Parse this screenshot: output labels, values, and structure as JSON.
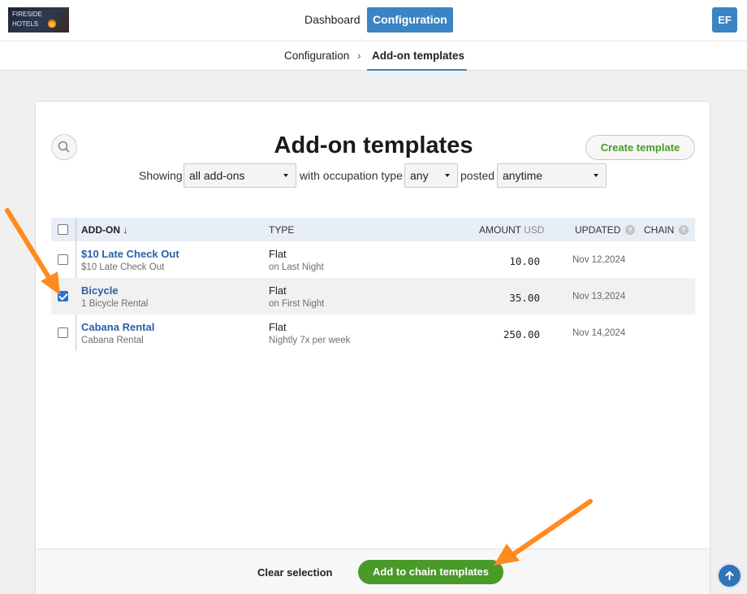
{
  "header": {
    "logo_text": "FIRESIDE HOTELS",
    "nav": [
      {
        "label": "Dashboard",
        "active": false
      },
      {
        "label": "Configuration",
        "active": true
      }
    ],
    "avatar_initials": "EF",
    "accent_color": "#3a84c4"
  },
  "breadcrumb": {
    "items": [
      "Configuration",
      "Add-on templates"
    ],
    "separator": "›"
  },
  "page": {
    "title": "Add-on templates",
    "create_button": "Create template"
  },
  "filters": {
    "showing_label": "Showing",
    "addons_value": "all add-ons",
    "occupation_label": "with occupation type",
    "occupation_value": "any",
    "posted_label": "posted",
    "posted_value": "anytime"
  },
  "table": {
    "columns": {
      "addon": "ADD-ON ↓",
      "type": "TYPE",
      "amount": "AMOUNT",
      "currency": "USD",
      "updated": "UPDATED",
      "chain": "CHAIN",
      "help_glyph": "?"
    },
    "rows": [
      {
        "name": "$10 Late Check Out",
        "subtitle": "$10 Late Check Out",
        "type": "Flat",
        "type_detail": "on Last Night",
        "amount": "10.00",
        "updated": "Nov 12,2024",
        "checked": false
      },
      {
        "name": "Bicycle",
        "subtitle": "1 Bicycle Rental",
        "type": "Flat",
        "type_detail": "on First Night",
        "amount": "35.00",
        "updated": "Nov 13,2024",
        "checked": true
      },
      {
        "name": "Cabana Rental",
        "subtitle": "Cabana Rental",
        "type": "Flat",
        "type_detail": "Nightly 7x per week",
        "amount": "250.00",
        "updated": "Nov 14,2024",
        "checked": false
      }
    ]
  },
  "footer": {
    "clear_label": "Clear selection",
    "add_chain_label": "Add to chain templates",
    "primary_color": "#4a9a28"
  },
  "annotations": {
    "arrow_color": "#ff8a1f"
  }
}
